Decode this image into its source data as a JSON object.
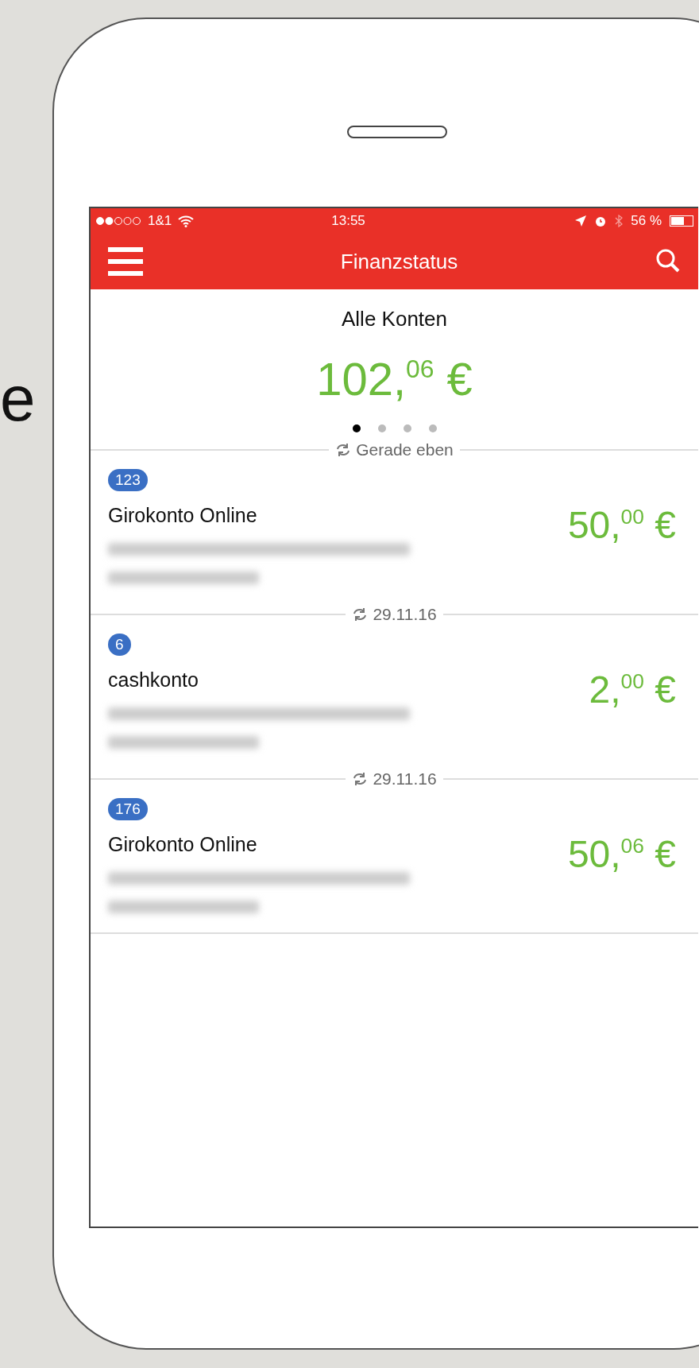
{
  "side_text": "e",
  "status_bar": {
    "carrier": "1&1",
    "time": "13:55",
    "battery": "56 %"
  },
  "nav_bar": {
    "title": "Finanzstatus"
  },
  "summary": {
    "title": "Alle Konten",
    "total": "102,$^{06}$ €",
    "pages": [
      {
        "selected": true
      },
      {
        "selected": false
      },
      {
        "selected": false
      },
      {
        "selected": false
      }
    ]
  },
  "accounts": [
    {
      "updated": "Gerade eben",
      "badge": "123",
      "name": "Girokonto Online",
      "amount": "50,$^{00}$ €"
    },
    {
      "updated": "29.11.16",
      "badge": "6",
      "name": "cashkonto",
      "amount": "2,$^{00}$ €"
    },
    {
      "updated": "29.11.16",
      "badge": "176",
      "name": "Girokonto Online",
      "amount": "50,$^{06}$ €"
    }
  ]
}
